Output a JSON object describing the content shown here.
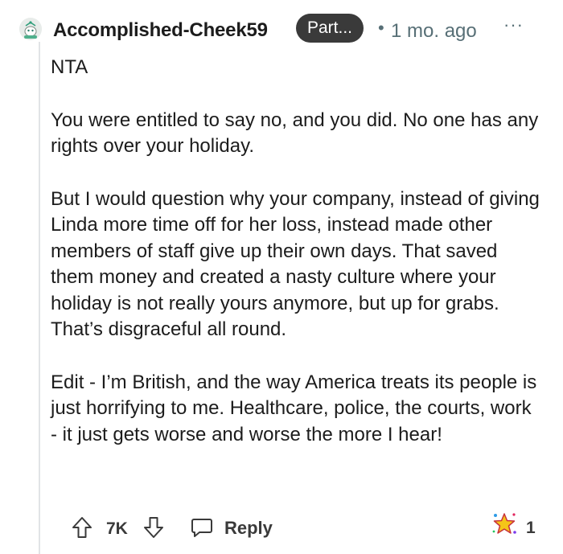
{
  "comment": {
    "username": "Accomplished-Cheek59",
    "flair": "Part...",
    "separator": "•",
    "time": "1 mo. ago",
    "more_menu": "···",
    "paragraphs": [
      "NTA",
      "You were entitled to say no, and you did. No one has any rights over your holiday.",
      "But I would question why your company, instead of giving Linda more time off for her loss, instead made other members of staff give up their own days. That saved them money and created a nasty culture where your holiday is not really yours anymore, but up for grabs. That’s disgraceful all round.",
      "Edit - I’m British, and the way America treats its people is just horrifying to me. Healthcare, police, the courts, work - it just gets worse and worse the more I hear!"
    ]
  },
  "actions": {
    "vote_count": "7K",
    "reply_label": "Reply",
    "award_count": "1"
  },
  "icons": {
    "avatar": "snoo-avatar-icon",
    "upvote": "arrow-up-icon",
    "downvote": "arrow-down-icon",
    "reply": "speech-bubble-icon",
    "award": "star-award-icon"
  },
  "colors": {
    "text": "#1c1c1c",
    "meta": "#576f76",
    "flair_bg": "#3a3a3a",
    "thread_line": "#e1e4e6"
  }
}
